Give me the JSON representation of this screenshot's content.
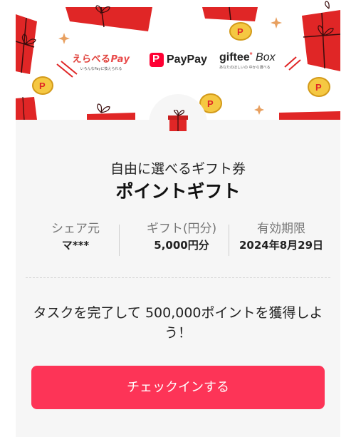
{
  "banner": {
    "erabe_logo": {
      "main": "えらべる",
      "pay": "Pay",
      "tagline": "いろんなPayに換えられる"
    },
    "paypay_logo": {
      "mark": "P",
      "text": "PayPay"
    },
    "giftee_logo": {
      "main": "giftee",
      "star": "*",
      "box": "Box",
      "tagline": "あなたのほしいの 中から選べる"
    }
  },
  "gift": {
    "subtitle": "自由に選べるギフト券",
    "title": "ポイントギフト"
  },
  "info": [
    {
      "label": "シェア元",
      "value": "マ***"
    },
    {
      "label": "ギフト(円分)",
      "value": "5,000円分"
    },
    {
      "label": "有効期限",
      "value": "2024年8月29日"
    }
  ],
  "message": "タスクを完了して 500,000ポイントを獲得しよう！",
  "cta": {
    "label": "チェックインする"
  },
  "colors": {
    "accent": "#fd3457",
    "paypay_red": "#ff0033",
    "coin": "#f5c842",
    "present": "#e02626"
  }
}
